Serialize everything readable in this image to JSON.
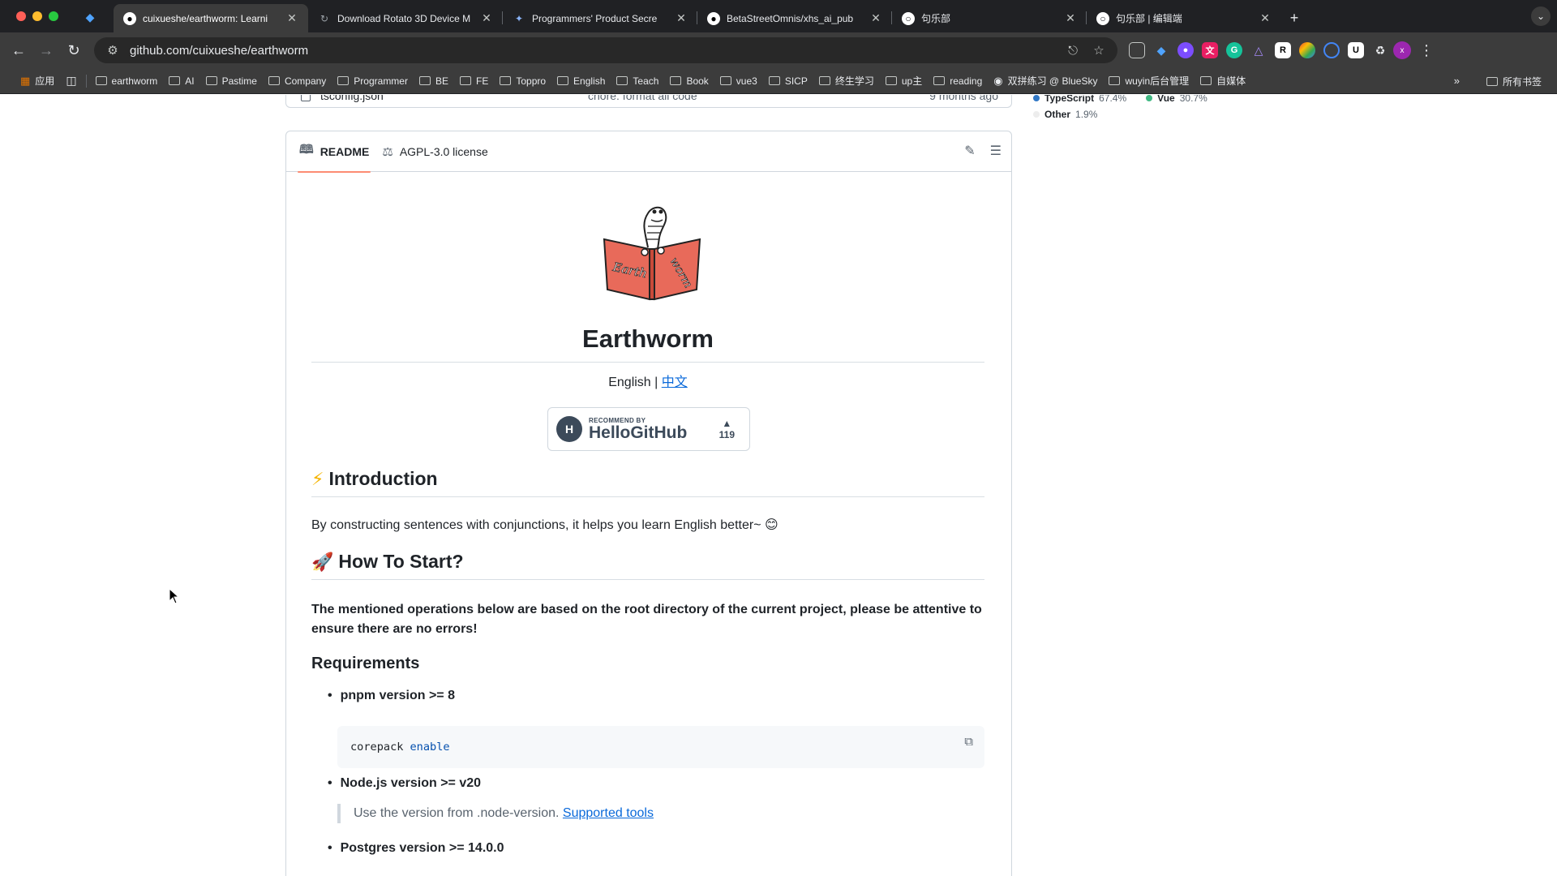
{
  "browser": {
    "tabs": [
      {
        "title": "cuixueshe/earthworm: Learni",
        "active": true,
        "icon": "github-icon"
      },
      {
        "title": "Download Rotato 3D Device M",
        "active": false,
        "icon": "rotato-icon"
      },
      {
        "title": "Programmers' Product Secre",
        "active": false,
        "icon": "butterfly-icon"
      },
      {
        "title": "BetaStreetOmnis/xhs_ai_pub",
        "active": false,
        "icon": "github-icon"
      },
      {
        "title": "句乐部",
        "active": false,
        "icon": "juleibu-icon"
      },
      {
        "title": "句乐部 | 编辑端",
        "active": false,
        "icon": "juleibu-icon"
      }
    ],
    "url": "github.com/cuixueshe/earthworm",
    "profile_initial": "x",
    "bookmarks": [
      {
        "label": "应用",
        "type": "apps"
      },
      {
        "label": "earthworm",
        "type": "folder"
      },
      {
        "label": "AI",
        "type": "folder"
      },
      {
        "label": "Pastime",
        "type": "folder"
      },
      {
        "label": "Company",
        "type": "folder"
      },
      {
        "label": "Programmer",
        "type": "folder"
      },
      {
        "label": "BE",
        "type": "folder"
      },
      {
        "label": "FE",
        "type": "folder"
      },
      {
        "label": "Toppro",
        "type": "folder"
      },
      {
        "label": "English",
        "type": "folder"
      },
      {
        "label": "Teach",
        "type": "folder"
      },
      {
        "label": "Book",
        "type": "folder"
      },
      {
        "label": "vue3",
        "type": "folder"
      },
      {
        "label": "SICP",
        "type": "folder"
      },
      {
        "label": "终生学习",
        "type": "folder"
      },
      {
        "label": "up主",
        "type": "folder"
      },
      {
        "label": "reading",
        "type": "folder"
      },
      {
        "label": "双拼练习 @ BlueSky",
        "type": "link"
      },
      {
        "label": "wuyin后台管理",
        "type": "folder"
      },
      {
        "label": "自媒体",
        "type": "folder"
      }
    ],
    "all_bookmarks_label": "所有书签"
  },
  "file_row": {
    "name": "tsconfig.json",
    "message": "chore: format all code",
    "date": "9 months ago"
  },
  "readme": {
    "tabs": [
      {
        "label": "README",
        "icon": "book-icon",
        "active": true
      },
      {
        "label": "AGPL-3.0 license",
        "icon": "scale-icon",
        "active": false
      }
    ],
    "title": "Earthworm",
    "lang_current": "English |",
    "lang_link": "中文",
    "badge": {
      "small": "RECOMMEND BY",
      "big": "HelloGitHub",
      "arrow": "▲",
      "count": "119"
    },
    "logo_text": {
      "left": "Earth",
      "right": "worm"
    },
    "intro_heading": {
      "emoji": "⚡",
      "text": "Introduction"
    },
    "intro_text": "By constructing sentences with conjunctions, it helps you learn English better~ 😊",
    "start_heading": {
      "emoji": "🚀",
      "text": "How To Start?"
    },
    "start_text": "The mentioned operations below are based on the root directory of the current project, please be attentive to ensure there are no errors!",
    "requirements_heading": "Requirements",
    "req_pnpm": "pnpm version >= 8",
    "code_cmd": "corepack",
    "code_arg": "enable",
    "req_node": "Node.js version >= v20",
    "node_note": "Use the version from .node-version.",
    "node_link": "Supported tools",
    "req_postgres": "Postgres version >= 14.0.0"
  },
  "languages": [
    {
      "name": "TypeScript",
      "percent": "67.4%",
      "color": "#3178c6"
    },
    {
      "name": "Vue",
      "percent": "30.7%",
      "color": "#41b883"
    },
    {
      "name": "Other",
      "percent": "1.9%",
      "color": "#ededed"
    }
  ]
}
